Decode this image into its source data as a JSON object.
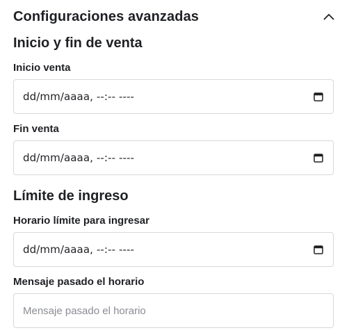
{
  "header": {
    "title": "Configuraciones avanzadas",
    "toggle_icon": "chevron-up-icon"
  },
  "sale_section": {
    "title": "Inicio y fin de venta",
    "start": {
      "label": "Inicio venta",
      "value": "dd/mm/aaaa, --:-- ----",
      "icon": "calendar-icon"
    },
    "end": {
      "label": "Fin venta",
      "value": "dd/mm/aaaa, --:-- ----",
      "icon": "calendar-icon"
    }
  },
  "entry_section": {
    "title": "Límite de ingreso",
    "limit_time": {
      "label": "Horario límite para ingresar",
      "value": "dd/mm/aaaa, --:-- ----",
      "icon": "calendar-icon"
    },
    "message": {
      "label": "Mensaje pasado el horario",
      "placeholder": "Mensaje pasado el horario",
      "value": ""
    }
  },
  "colors": {
    "text": "#1f2024",
    "border": "#d7d8dc",
    "placeholder": "#8a8c92"
  }
}
